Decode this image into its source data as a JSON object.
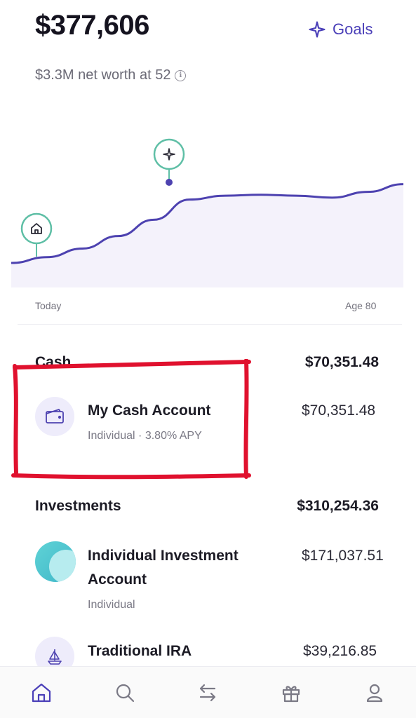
{
  "header": {
    "balance": "$377,606",
    "goals_label": "Goals",
    "net_worth_text": "$3.3M net worth at 52"
  },
  "chart_data": {
    "type": "line",
    "series": [
      {
        "values": [
          0.0,
          0.06,
          0.15,
          0.28,
          0.45,
          0.66,
          0.7,
          0.71,
          0.7,
          0.68,
          0.74,
          0.82
        ]
      }
    ],
    "markers": [
      "home-icon",
      "sparkle-icon"
    ],
    "xlabel_start": "Today",
    "xlabel_end": "Age 80"
  },
  "colors": {
    "accent": "#4a3fb8",
    "line": "#4d42b0",
    "fill": "#f4f2fb",
    "marker_ring": "#5fbfa6",
    "highlight_red": "#e0112e"
  },
  "cash": {
    "title": "Cash",
    "total": "$70,351.48",
    "accounts": [
      {
        "name": "My Cash Account",
        "sub": "Individual · 3.80% APY",
        "amount": "$70,351.48",
        "icon": "wallet-icon"
      }
    ]
  },
  "investments": {
    "title": "Investments",
    "total": "$310,254.36",
    "accounts": [
      {
        "name_line1": "Individual Investment",
        "name_line2": "Account",
        "sub": "Individual",
        "amount": "$171,037.51",
        "icon": "leaf-logo-icon"
      },
      {
        "name": "Traditional IRA",
        "amount": "$39,216.85",
        "icon": "sailboat-icon"
      }
    ]
  },
  "tabbar": {
    "items": [
      "home-icon",
      "search-icon",
      "transfer-icon",
      "gift-icon",
      "profile-icon"
    ]
  }
}
